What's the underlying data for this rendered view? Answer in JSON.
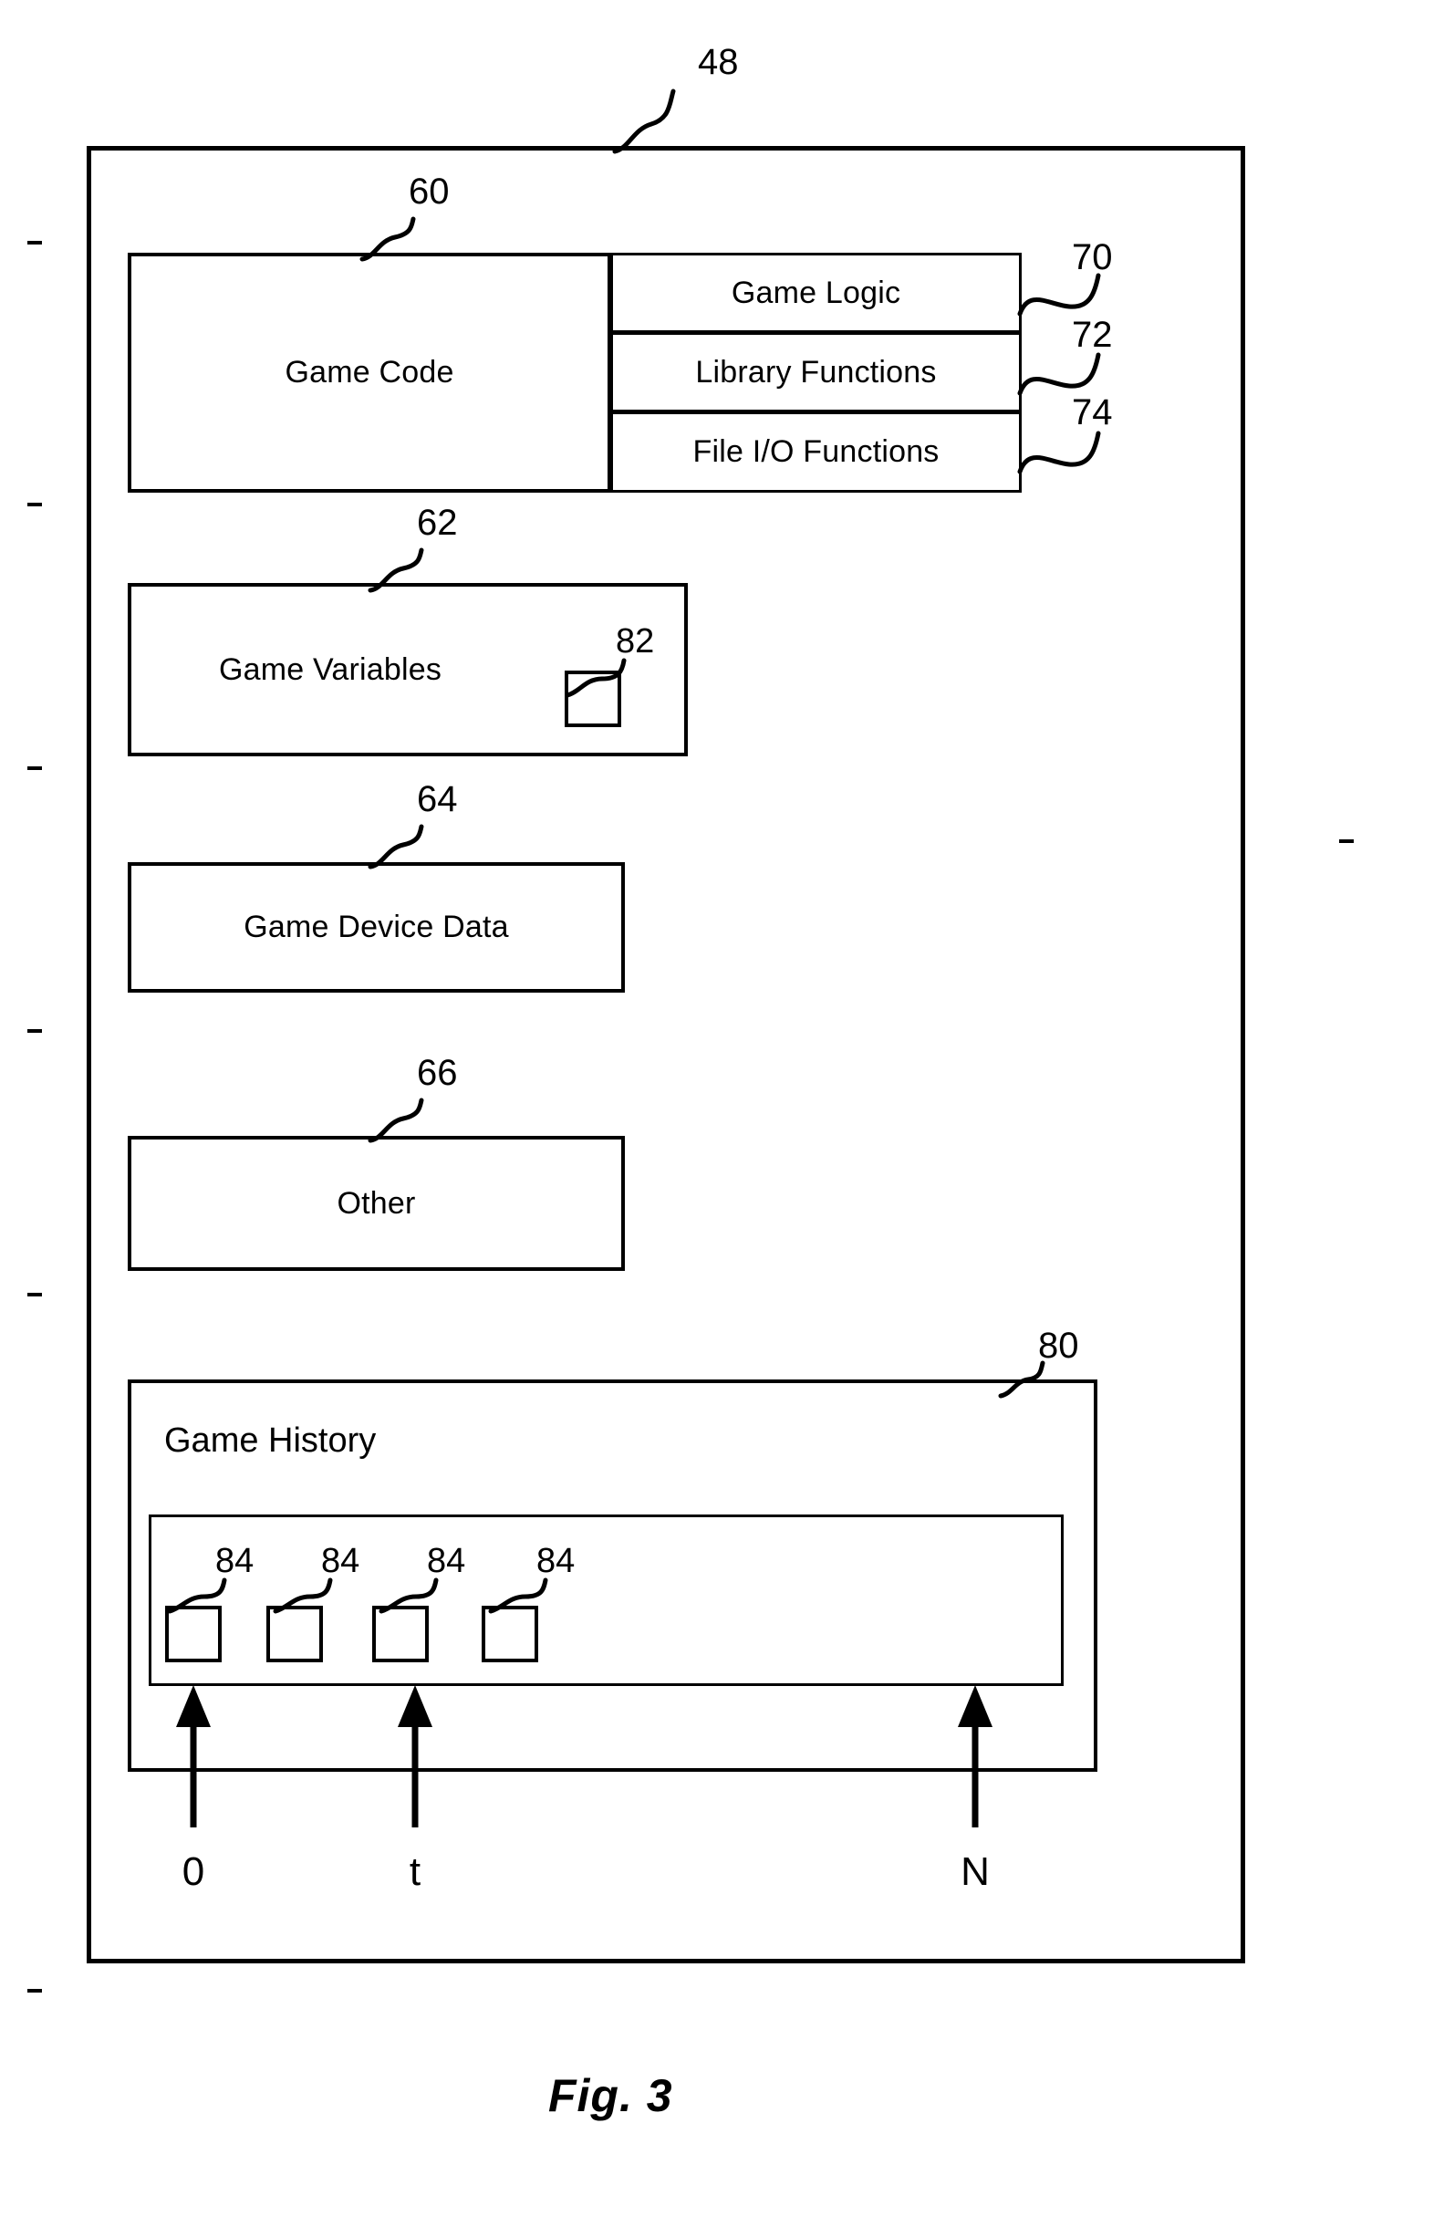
{
  "figure": {
    "caption": "Fig. 3",
    "outer_ref": "48"
  },
  "blocks": {
    "game_code": {
      "label": "Game Code",
      "ref": "60",
      "subblocks": [
        {
          "label": "Game Logic",
          "ref": "70"
        },
        {
          "label": "Library Functions",
          "ref": "72"
        },
        {
          "label": "File I/O Functions",
          "ref": "74"
        }
      ]
    },
    "game_variables": {
      "label": "Game Variables",
      "ref": "62",
      "inner_square_ref": "82"
    },
    "game_device_data": {
      "label": "Game Device Data",
      "ref": "64"
    },
    "other": {
      "label": "Other",
      "ref": "66"
    },
    "game_history": {
      "label": "Game History",
      "ref": "80",
      "state_refs": [
        "84",
        "84",
        "84",
        "84"
      ],
      "timeline_labels": [
        "0",
        "t",
        "N"
      ]
    }
  },
  "colors": {
    "ink": "#000000",
    "paper": "#ffffff"
  }
}
